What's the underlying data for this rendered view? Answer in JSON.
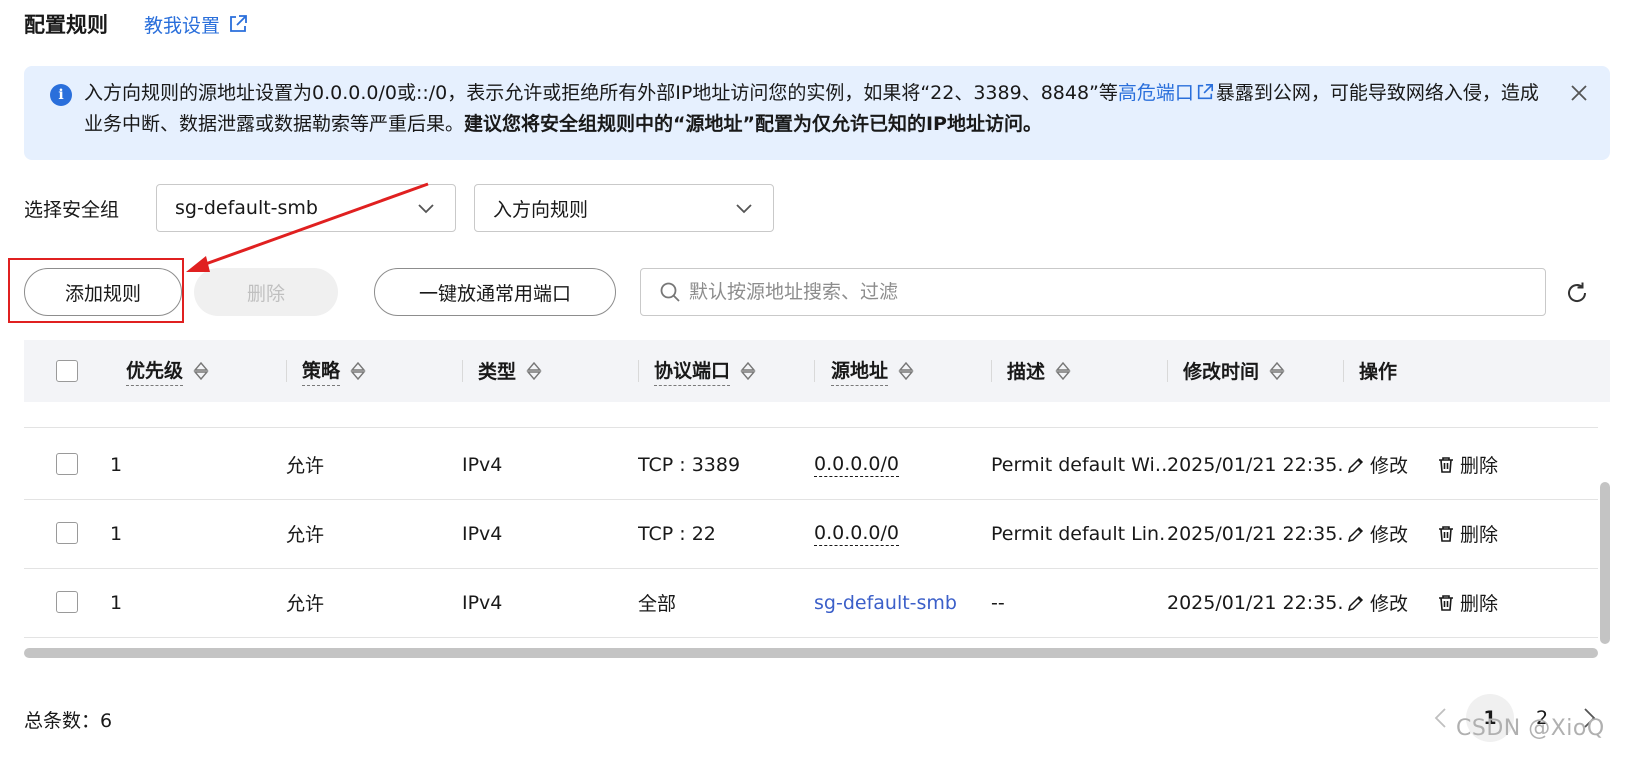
{
  "header": {
    "title": "配置规则",
    "help_link": "教我设置"
  },
  "alert": {
    "text_part1": "入方向规则的源地址设置为0.0.0.0/0或::/0，表示允许或拒绝所有外部IP地址访问您的实例，如果将“22、3389、8848”等",
    "link_text": "高危端口",
    "text_part2": "暴露到公网，可能导致网络入侵，造成业务中断、数据泄露或数据勒索等严重后果。",
    "bold_text": "建议您将安全组规则中的“源地址”配置为仅允许已知的IP地址访问。"
  },
  "selectors": {
    "label": "选择安全组",
    "security_group": "sg-default-smb",
    "direction": "入方向规则"
  },
  "toolbar": {
    "add_label": "添加规则",
    "delete_label": "删除",
    "open_ports_label": "一键放通常用端口",
    "search_placeholder": "默认按源地址搜索、过滤"
  },
  "table": {
    "columns": [
      "优先级",
      "策略",
      "类型",
      "协议端口",
      "源地址",
      "描述",
      "修改时间",
      "操作"
    ],
    "rows": [
      {
        "priority": "1",
        "policy": "允许",
        "type": "IPv4",
        "port": "TCP : 3389",
        "source": "0.0.0.0/0",
        "description": "Permit default Wi…",
        "modified": "2025/01/21 22:35…",
        "edit": "修改",
        "delete": "删除"
      },
      {
        "priority": "1",
        "policy": "允许",
        "type": "IPv4",
        "port": "TCP : 22",
        "source": "0.0.0.0/0",
        "description": "Permit default Lin…",
        "modified": "2025/01/21 22:35…",
        "edit": "修改",
        "delete": "删除"
      },
      {
        "priority": "1",
        "policy": "允许",
        "type": "IPv4",
        "port": "全部",
        "source": "sg-default-smb",
        "description": "--",
        "modified": "2025/01/21 22:35…",
        "edit": "修改",
        "delete": "删除"
      }
    ]
  },
  "footer": {
    "total": "总条数：6",
    "pages": [
      "1",
      "2"
    ],
    "current_page": "1",
    "watermark": "CSDN @XioQ"
  },
  "colors": {
    "accent": "#2a6fdb",
    "alert_bg": "#e6f0fe",
    "highlight_red": "#e02020",
    "link_blue": "#3b5fc9"
  }
}
